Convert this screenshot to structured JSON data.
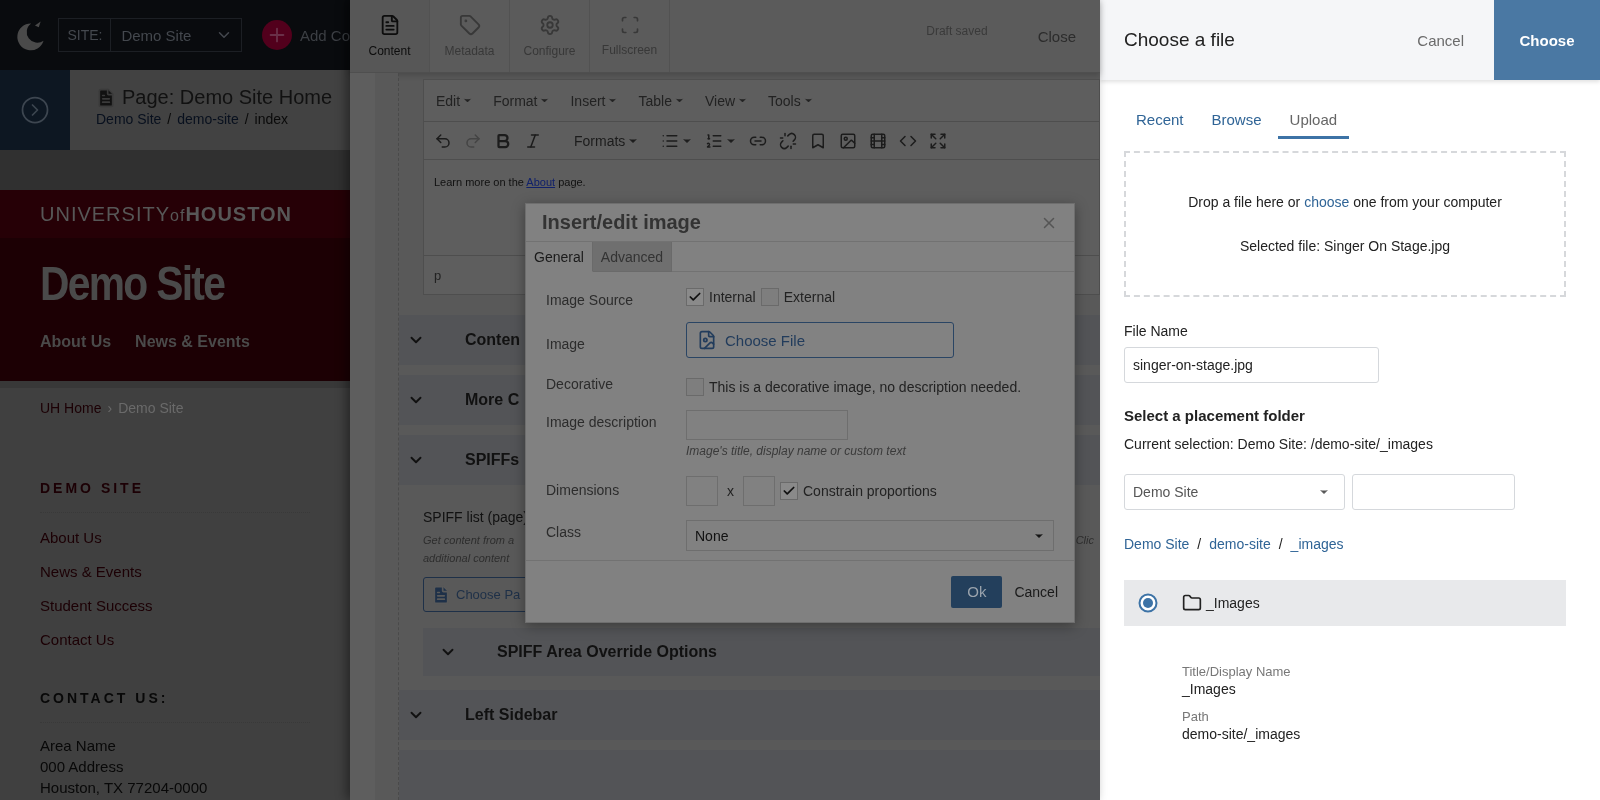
{
  "top_bar": {
    "site_label": "SITE:",
    "site_value": "Demo Site",
    "add_label": "Add Co"
  },
  "page_header": {
    "title": "Page: Demo Site Home",
    "breadcrumb": [
      {
        "label": "Demo Site",
        "kind": "link"
      },
      {
        "label": "/",
        "kind": "sep"
      },
      {
        "label": "demo-site",
        "kind": "link"
      },
      {
        "label": "/",
        "kind": "sep"
      },
      {
        "label": "index",
        "kind": "current"
      }
    ]
  },
  "site_preview": {
    "brand_light": "UNIVERSITY",
    "brand_of": "of",
    "brand_bold": "HOUSTON",
    "site_title": "Demo Site",
    "nav": [
      "About Us",
      "News & Events"
    ],
    "breadcrumb": [
      {
        "label": "UH Home",
        "kind": "link"
      },
      {
        "label": "›",
        "kind": "sep"
      },
      {
        "label": "Demo Site",
        "kind": "current"
      }
    ],
    "sidebar_heading": "DEMO SITE",
    "sidebar_links": [
      "About Us",
      "News & Events",
      "Student Success",
      "Contact Us"
    ],
    "contact_heading": "CONTACT US:",
    "address": [
      "Area Name",
      "000 Address",
      "Houston, TX 77204-0000"
    ]
  },
  "editor": {
    "tabs": [
      {
        "label": "Content",
        "selected": true
      },
      {
        "label": "Metadata",
        "selected": false
      },
      {
        "label": "Configure",
        "selected": false
      },
      {
        "label": "Fullscreen",
        "selected": false
      }
    ],
    "status": "Draft saved",
    "close": "Close",
    "menu": [
      "Edit",
      "Format",
      "Insert",
      "Table",
      "View",
      "Tools"
    ],
    "formats": "Formats",
    "toolbar": [
      {
        "kind": "undo",
        "disabled": false
      },
      {
        "kind": "redo",
        "disabled": true
      },
      {
        "kind": "bold",
        "disabled": false
      },
      {
        "kind": "italic",
        "disabled": false
      },
      {
        "kind": "formats",
        "disabled": false
      },
      {
        "kind": "bullets",
        "disabled": false
      },
      {
        "kind": "numbers",
        "disabled": false
      },
      {
        "kind": "link",
        "disabled": false
      },
      {
        "kind": "unlink",
        "disabled": false
      },
      {
        "kind": "bookmark",
        "disabled": false
      },
      {
        "kind": "image",
        "disabled": false
      },
      {
        "kind": "media",
        "disabled": false
      },
      {
        "kind": "code",
        "disabled": false
      },
      {
        "kind": "fullscreen",
        "disabled": false
      }
    ],
    "content_before": "Learn more on the ",
    "content_link": "About",
    "content_after": " page.",
    "status_path": "p"
  },
  "sections": [
    {
      "title": "Conten"
    },
    {
      "title": "More C"
    },
    {
      "title": "SPIFFs",
      "field_label": "SPIFF list (page)",
      "help_left": [
        "Get content from a",
        "additional content"
      ],
      "help_right": "Clic",
      "button": "Choose Pa",
      "subsections": [
        {
          "title": "SPIFF Area Override Options"
        }
      ]
    },
    {
      "title": "Left Sidebar"
    }
  ],
  "dialog": {
    "title": "Insert/edit image",
    "tabs": [
      {
        "label": "General",
        "selected": true
      },
      {
        "label": "Advanced",
        "selected": false
      }
    ],
    "rows": [
      {
        "kind": "source",
        "label": "Image Source",
        "options": [
          {
            "label": "Internal",
            "checked": true
          },
          {
            "label": "External",
            "checked": false
          }
        ]
      },
      {
        "kind": "file",
        "label": "Image",
        "button": "Choose File"
      },
      {
        "kind": "checkbox",
        "label": "Decorative",
        "text": "This is a decorative image, no description needed.",
        "checked": false
      },
      {
        "kind": "text",
        "label": "Image description",
        "hint": "Image's title, display name or custom text"
      },
      {
        "kind": "dimensions",
        "label": "Dimensions",
        "separator": "x",
        "text": "Constrain proportions",
        "checked": true
      },
      {
        "kind": "select",
        "label": "Class",
        "value": "None"
      }
    ],
    "ok": "Ok",
    "cancel": "Cancel"
  },
  "file_panel": {
    "title": "Choose a file",
    "cancel": "Cancel",
    "choose": "Choose",
    "tabs": [
      {
        "label": "Recent",
        "selected": false
      },
      {
        "label": "Browse",
        "selected": false
      },
      {
        "label": "Upload",
        "selected": true
      }
    ],
    "drop_before": "Drop a file here or ",
    "drop_link": "choose",
    "drop_after": " one from your computer",
    "selected_file": "Selected file: Singer On Stage.jpg",
    "file_name_label": "File Name",
    "file_name_value": "singer-on-stage.jpg",
    "folder_heading": "Select a placement folder",
    "current_selection": "Current selection: Demo Site: /demo-site/_images",
    "site_select": "Demo Site",
    "path": [
      {
        "label": "Demo Site",
        "kind": "link"
      },
      {
        "label": "/",
        "kind": "sep"
      },
      {
        "label": "demo-site",
        "kind": "link"
      },
      {
        "label": "/",
        "kind": "sep"
      },
      {
        "label": "_images",
        "kind": "link"
      }
    ],
    "folders": [
      {
        "name": "_Images",
        "selected": true,
        "details": [
          {
            "label": "Title/Display Name",
            "value": "_Images"
          },
          {
            "label": "Path",
            "value": "demo-site/_images"
          }
        ]
      }
    ]
  }
}
